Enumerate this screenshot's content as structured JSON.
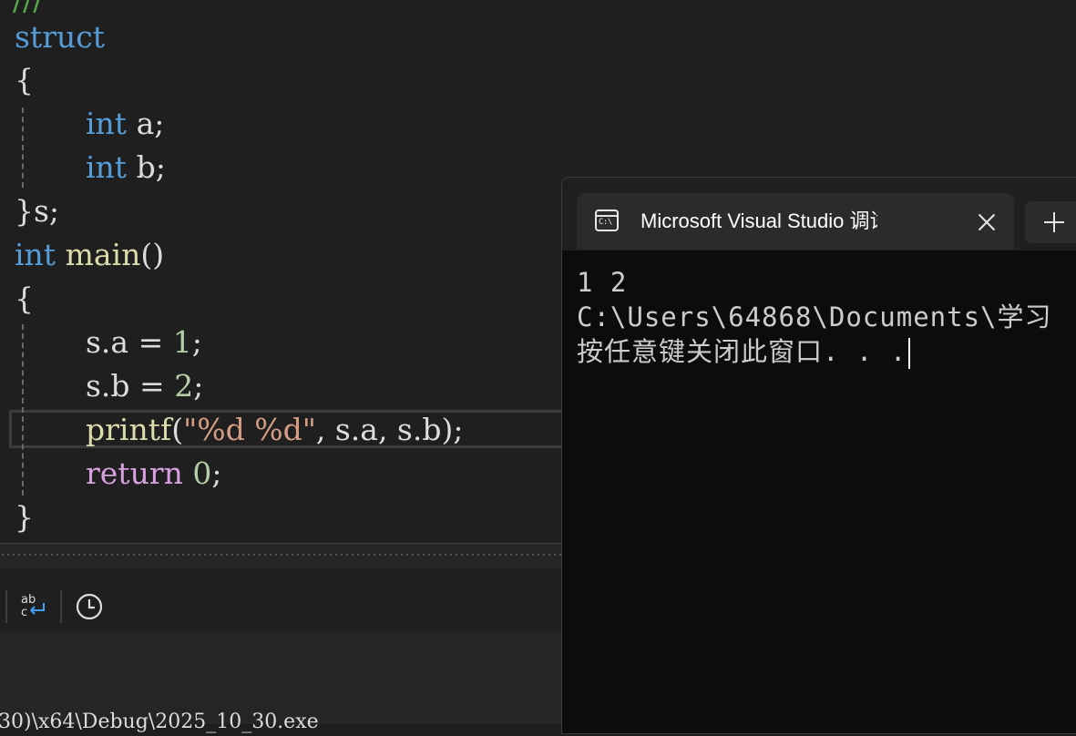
{
  "editor": {
    "lines": {
      "l0": "///",
      "l1_kw": "struct",
      "l2": "{",
      "l3_kw": "int",
      "l3_rest": " a;",
      "l4_kw": "int",
      "l4_rest": " b;",
      "l5": "}s;",
      "l6_kw": "int",
      "l6_fn": "main",
      "l6_rest": "()",
      "l7": "{",
      "l8_a": "s.a = ",
      "l8_num": "1",
      "l8_end": ";",
      "l9_a": "s.b = ",
      "l9_num": "2",
      "l9_end": ";",
      "l10_fn": "printf",
      "l10_open": "(",
      "l10_str": "\"%d %d\"",
      "l10_rest": ", s.a, s.b);",
      "l11_kw": "return",
      "l11_num": "0",
      "l11_end": ";",
      "l12": "}"
    }
  },
  "bottom_panel": {
    "toolbar": {
      "word_wrap_icon": "word-wrap-icon",
      "history_icon": "clock-icon"
    },
    "output_path": "30)\\x64\\Debug\\2025_10_30.exe"
  },
  "terminal": {
    "tab_title": "Microsoft Visual Studio 调试控制台",
    "output_lines": [
      "1 2",
      "C:\\Users\\64868\\Documents\\学习",
      "按任意键关闭此窗口. . ."
    ]
  },
  "colors": {
    "keyword": "#569cd6",
    "control_keyword": "#d8a0df",
    "function": "#dcdcaa",
    "number": "#b5cea8",
    "string": "#d69d85"
  }
}
